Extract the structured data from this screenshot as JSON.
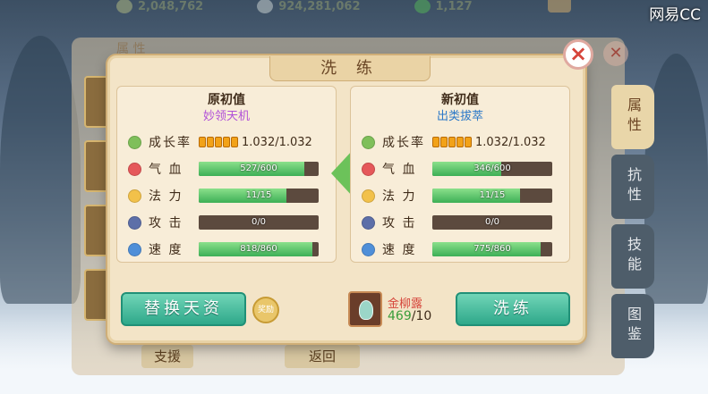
{
  "watermark": "网易CC",
  "currencies": [
    {
      "icon": "gold-coin-icon",
      "amount": "2,048,762"
    },
    {
      "icon": "silver-ingot-icon",
      "amount": "924,281,062"
    },
    {
      "icon": "jade-icon",
      "amount": "1,127"
    }
  ],
  "background_window": {
    "title": "属 性",
    "side_tabs": [
      {
        "label": "属性",
        "active": true
      },
      {
        "label": "抗性",
        "active": false
      },
      {
        "label": "技能",
        "active": false
      },
      {
        "label": "图鉴",
        "active": false
      }
    ],
    "assist_label": "支援",
    "return_label": "返回"
  },
  "dialog": {
    "title": "洗 练",
    "original": {
      "heading": "原初值",
      "aptitude": "妙领天机",
      "growth_label": "成长率",
      "growth_value": "1.032/1.032",
      "growth_stars": 5,
      "stats": [
        {
          "label": "气 血",
          "text": "527/600",
          "value": 527,
          "max": 600,
          "icon": "heart-icon"
        },
        {
          "label": "法 力",
          "text": "11/15",
          "value": 11,
          "max": 15,
          "icon": "mana-icon"
        },
        {
          "label": "攻 击",
          "text": "0/0",
          "value": 0,
          "max": 0,
          "icon": "sword-icon"
        },
        {
          "label": "速 度",
          "text": "818/860",
          "value": 818,
          "max": 860,
          "icon": "speed-icon"
        }
      ]
    },
    "new": {
      "heading": "新初值",
      "aptitude": "出类拔萃",
      "growth_label": "成长率",
      "growth_value": "1.032/1.032",
      "growth_stars": 5,
      "stats": [
        {
          "label": "气 血",
          "text": "346/600",
          "value": 346,
          "max": 600,
          "icon": "heart-icon"
        },
        {
          "label": "法 力",
          "text": "11/15",
          "value": 11,
          "max": 15,
          "icon": "mana-icon"
        },
        {
          "label": "攻 击",
          "text": "0/0",
          "value": 0,
          "max": 0,
          "icon": "sword-icon"
        },
        {
          "label": "速 度",
          "text": "775/860",
          "value": 775,
          "max": 860,
          "icon": "speed-icon"
        }
      ]
    },
    "replace_button": "替换天资",
    "refine_button": "洗练",
    "seal_label": "奖励",
    "item": {
      "name": "金柳露",
      "have": "469",
      "need": "10"
    }
  },
  "colors": {
    "bar_fill": "#3daf56",
    "button_green": "#2ea88a",
    "aptitude_purple": "#b04fd8",
    "aptitude_blue": "#2a78c8"
  }
}
